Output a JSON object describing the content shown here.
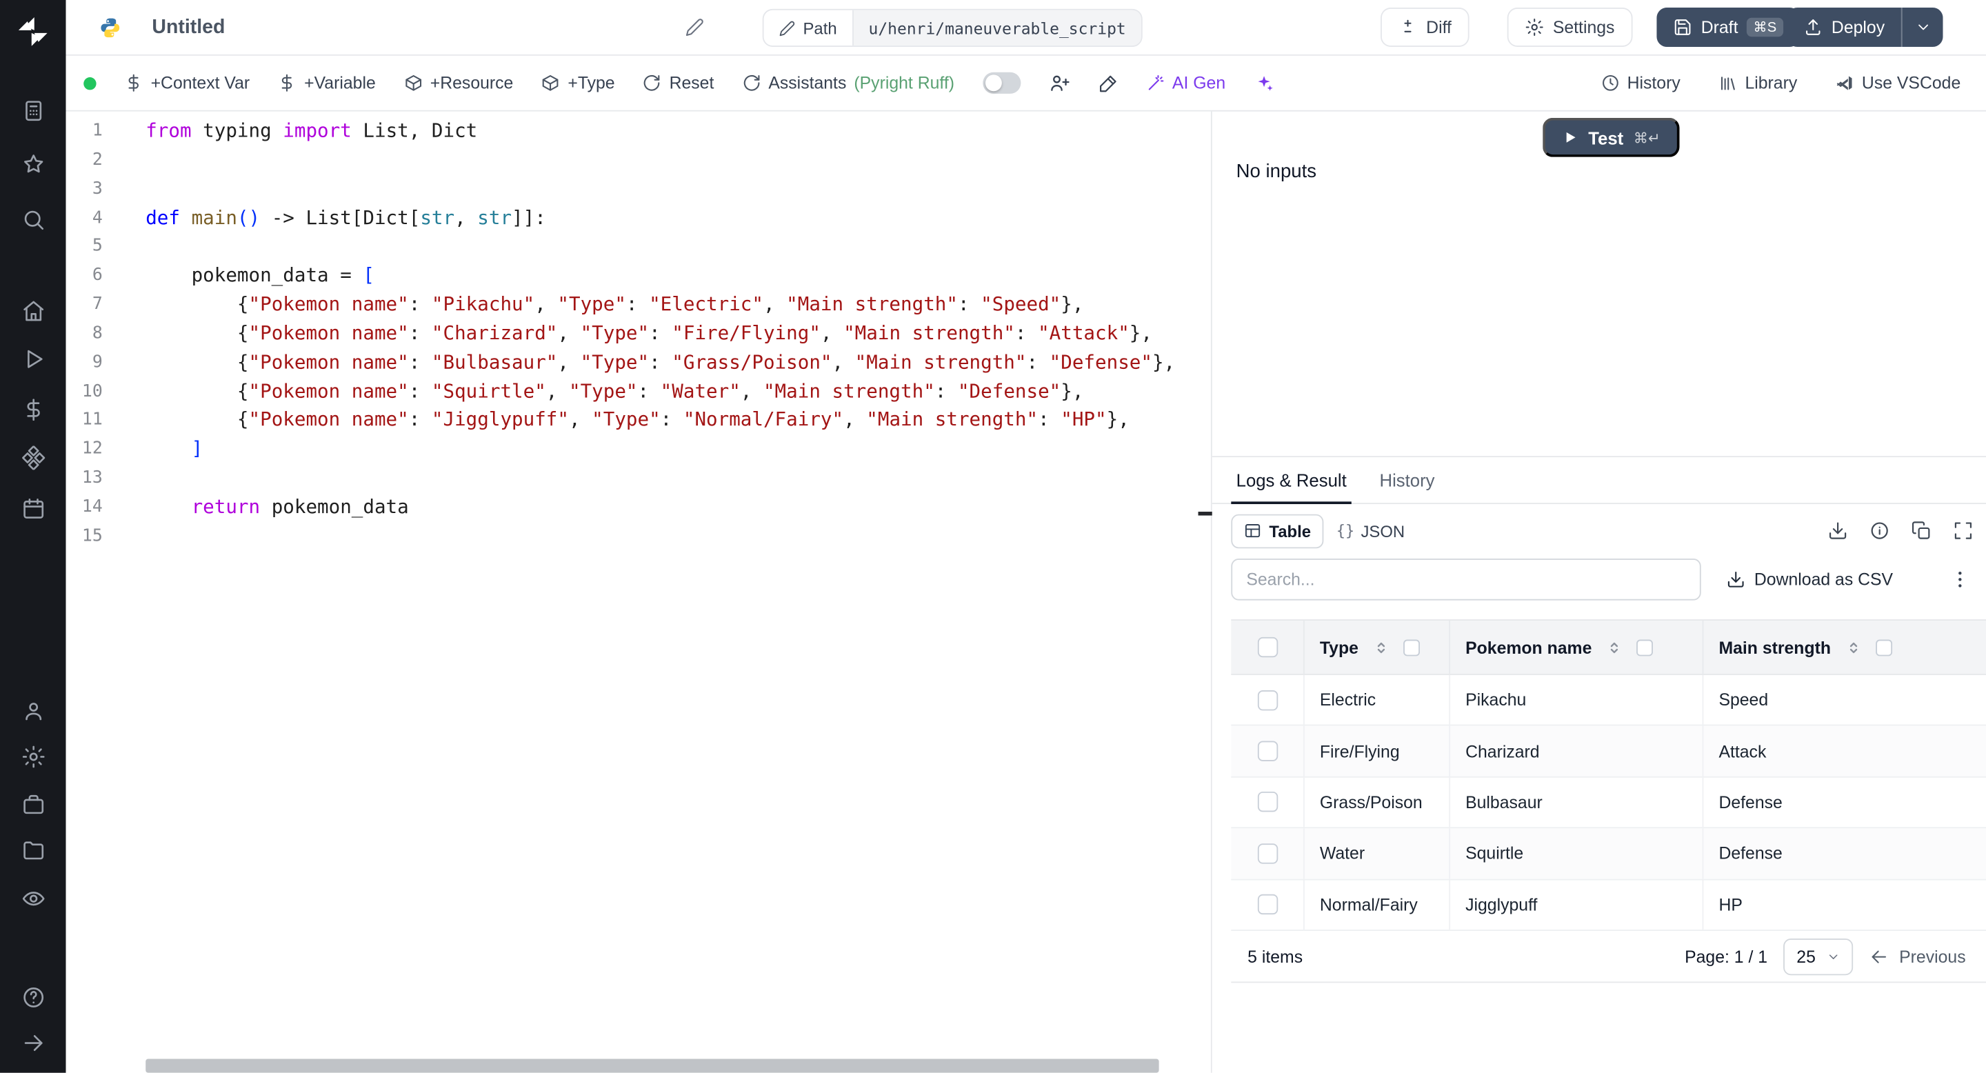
{
  "sidebar": {
    "icons": [
      "windmill-logo",
      "runs",
      "favorites",
      "search",
      "home",
      "flows",
      "variables",
      "resources",
      "schedules",
      "user",
      "settings",
      "workers",
      "folders",
      "audit",
      "help",
      "collapse"
    ]
  },
  "header": {
    "title": "Untitled",
    "path_label": "Path",
    "path_value": "u/henri/maneuverable_script",
    "diff_label": "Diff",
    "settings_label": "Settings",
    "draft_label": "Draft",
    "draft_shortcut": "⌘S",
    "deploy_label": "Deploy"
  },
  "toolbar": {
    "context_var": "+Context Var",
    "variable": "+Variable",
    "resource": "+Resource",
    "type": "+Type",
    "reset": "Reset",
    "assistants": "Assistants",
    "assistants_status": "(Pyright Ruff)",
    "ai_gen": "AI Gen",
    "history": "History",
    "library": "Library",
    "use_vscode": "Use VSCode"
  },
  "editor": {
    "language": "python",
    "lines": [
      {
        "n": "1",
        "t": [
          [
            "kw",
            "from"
          ],
          [
            "pl",
            " typing "
          ],
          [
            "kw",
            "import"
          ],
          [
            "pl",
            " List, Dict"
          ]
        ]
      },
      {
        "n": "2",
        "t": []
      },
      {
        "n": "3",
        "t": []
      },
      {
        "n": "4",
        "t": [
          [
            "kw2",
            "def"
          ],
          [
            "pl",
            " "
          ],
          [
            "fn",
            "main"
          ],
          [
            "br",
            "()"
          ],
          [
            "pl",
            " -> List[Dict["
          ],
          [
            "ty",
            "str"
          ],
          [
            "pl",
            ", "
          ],
          [
            "ty",
            "str"
          ],
          [
            "pl",
            "]]:"
          ]
        ]
      },
      {
        "n": "5",
        "t": []
      },
      {
        "n": "6",
        "t": [
          [
            "pl",
            "    pokemon_data = "
          ],
          [
            "br",
            "["
          ]
        ]
      },
      {
        "n": "7",
        "t": [
          [
            "pl",
            "        {"
          ],
          [
            "st",
            "\"Pokemon name\""
          ],
          [
            "pl",
            ": "
          ],
          [
            "st",
            "\"Pikachu\""
          ],
          [
            "pl",
            ", "
          ],
          [
            "st",
            "\"Type\""
          ],
          [
            "pl",
            ": "
          ],
          [
            "st",
            "\"Electric\""
          ],
          [
            "pl",
            ", "
          ],
          [
            "st",
            "\"Main strength\""
          ],
          [
            "pl",
            ": "
          ],
          [
            "st",
            "\"Speed\""
          ],
          [
            "pl",
            "},"
          ]
        ]
      },
      {
        "n": "8",
        "t": [
          [
            "pl",
            "        {"
          ],
          [
            "st",
            "\"Pokemon name\""
          ],
          [
            "pl",
            ": "
          ],
          [
            "st",
            "\"Charizard\""
          ],
          [
            "pl",
            ", "
          ],
          [
            "st",
            "\"Type\""
          ],
          [
            "pl",
            ": "
          ],
          [
            "st",
            "\"Fire/Flying\""
          ],
          [
            "pl",
            ", "
          ],
          [
            "st",
            "\"Main strength\""
          ],
          [
            "pl",
            ": "
          ],
          [
            "st",
            "\"Attack\""
          ],
          [
            "pl",
            "},"
          ]
        ]
      },
      {
        "n": "9",
        "t": [
          [
            "pl",
            "        {"
          ],
          [
            "st",
            "\"Pokemon name\""
          ],
          [
            "pl",
            ": "
          ],
          [
            "st",
            "\"Bulbasaur\""
          ],
          [
            "pl",
            ", "
          ],
          [
            "st",
            "\"Type\""
          ],
          [
            "pl",
            ": "
          ],
          [
            "st",
            "\"Grass/Poison\""
          ],
          [
            "pl",
            ", "
          ],
          [
            "st",
            "\"Main strength\""
          ],
          [
            "pl",
            ": "
          ],
          [
            "st",
            "\"Defense\""
          ],
          [
            "pl",
            "},"
          ]
        ]
      },
      {
        "n": "10",
        "t": [
          [
            "pl",
            "        {"
          ],
          [
            "st",
            "\"Pokemon name\""
          ],
          [
            "pl",
            ": "
          ],
          [
            "st",
            "\"Squirtle\""
          ],
          [
            "pl",
            ", "
          ],
          [
            "st",
            "\"Type\""
          ],
          [
            "pl",
            ": "
          ],
          [
            "st",
            "\"Water\""
          ],
          [
            "pl",
            ", "
          ],
          [
            "st",
            "\"Main strength\""
          ],
          [
            "pl",
            ": "
          ],
          [
            "st",
            "\"Defense\""
          ],
          [
            "pl",
            "},"
          ]
        ]
      },
      {
        "n": "11",
        "t": [
          [
            "pl",
            "        {"
          ],
          [
            "st",
            "\"Pokemon name\""
          ],
          [
            "pl",
            ": "
          ],
          [
            "st",
            "\"Jigglypuff\""
          ],
          [
            "pl",
            ", "
          ],
          [
            "st",
            "\"Type\""
          ],
          [
            "pl",
            ": "
          ],
          [
            "st",
            "\"Normal/Fairy\""
          ],
          [
            "pl",
            ", "
          ],
          [
            "st",
            "\"Main strength\""
          ],
          [
            "pl",
            ": "
          ],
          [
            "st",
            "\"HP\""
          ],
          [
            "pl",
            "},"
          ]
        ]
      },
      {
        "n": "12",
        "t": [
          [
            "pl",
            "    "
          ],
          [
            "br",
            "]"
          ]
        ]
      },
      {
        "n": "13",
        "t": []
      },
      {
        "n": "14",
        "t": [
          [
            "pl",
            "    "
          ],
          [
            "kw",
            "return"
          ],
          [
            "pl",
            " pokemon_data"
          ]
        ]
      },
      {
        "n": "15",
        "t": []
      }
    ]
  },
  "run": {
    "test_label": "Test",
    "test_shortcut": "⌘↵",
    "no_inputs": "No inputs"
  },
  "result": {
    "tabs": [
      {
        "label": "Logs & Result"
      },
      {
        "label": "History"
      }
    ],
    "views": [
      {
        "label": "Table"
      },
      {
        "label": "JSON",
        "prefix": "{}"
      }
    ],
    "search_placeholder": "Search...",
    "download_csv": "Download as CSV",
    "table": {
      "columns": [
        {
          "label": "Type"
        },
        {
          "label": "Pokemon name"
        },
        {
          "label": "Main strength"
        }
      ],
      "rows": [
        {
          "cells": [
            "Electric",
            "Pikachu",
            "Speed"
          ]
        },
        {
          "cells": [
            "Fire/Flying",
            "Charizard",
            "Attack"
          ]
        },
        {
          "cells": [
            "Grass/Poison",
            "Bulbasaur",
            "Defense"
          ]
        },
        {
          "cells": [
            "Water",
            "Squirtle",
            "Defense"
          ]
        },
        {
          "cells": [
            "Normal/Fairy",
            "Jigglypuff",
            "HP"
          ]
        }
      ]
    },
    "footer": {
      "items_count": "5 items",
      "page": "Page: 1 / 1",
      "page_size": "25",
      "previous": "Previous"
    }
  },
  "colors": {
    "dark_button": "#3e4d63",
    "status_green": "#22c55e",
    "ai_accent": "#7c3aed",
    "string_red": "#a31515"
  }
}
